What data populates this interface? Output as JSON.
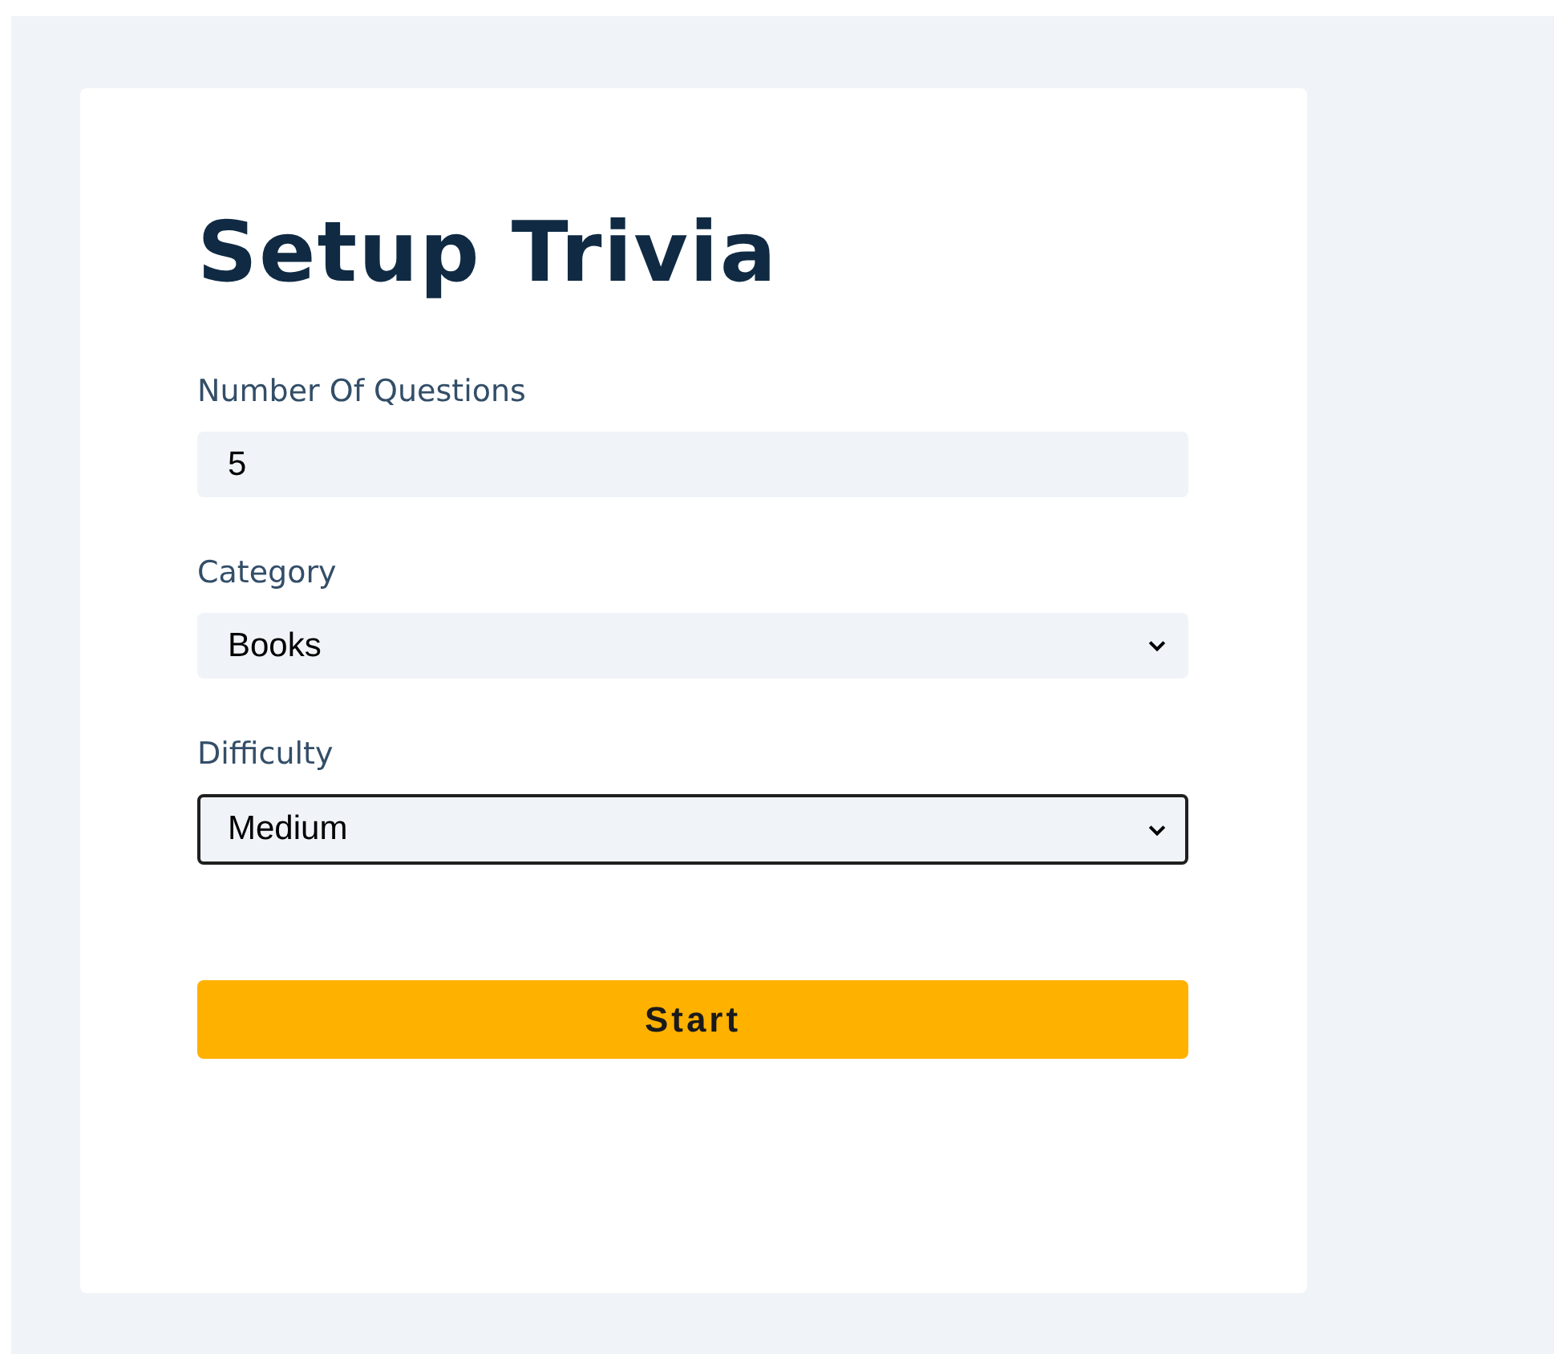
{
  "title": "Setup Trivia",
  "fields": [
    {
      "kind": "number",
      "label": "Number Of Questions",
      "value": "5",
      "focused": false
    },
    {
      "kind": "select",
      "label": "Category",
      "value": "Books",
      "focused": false
    },
    {
      "kind": "select",
      "label": "Difficulty",
      "value": "Medium",
      "focused": true
    }
  ],
  "button": "Start"
}
